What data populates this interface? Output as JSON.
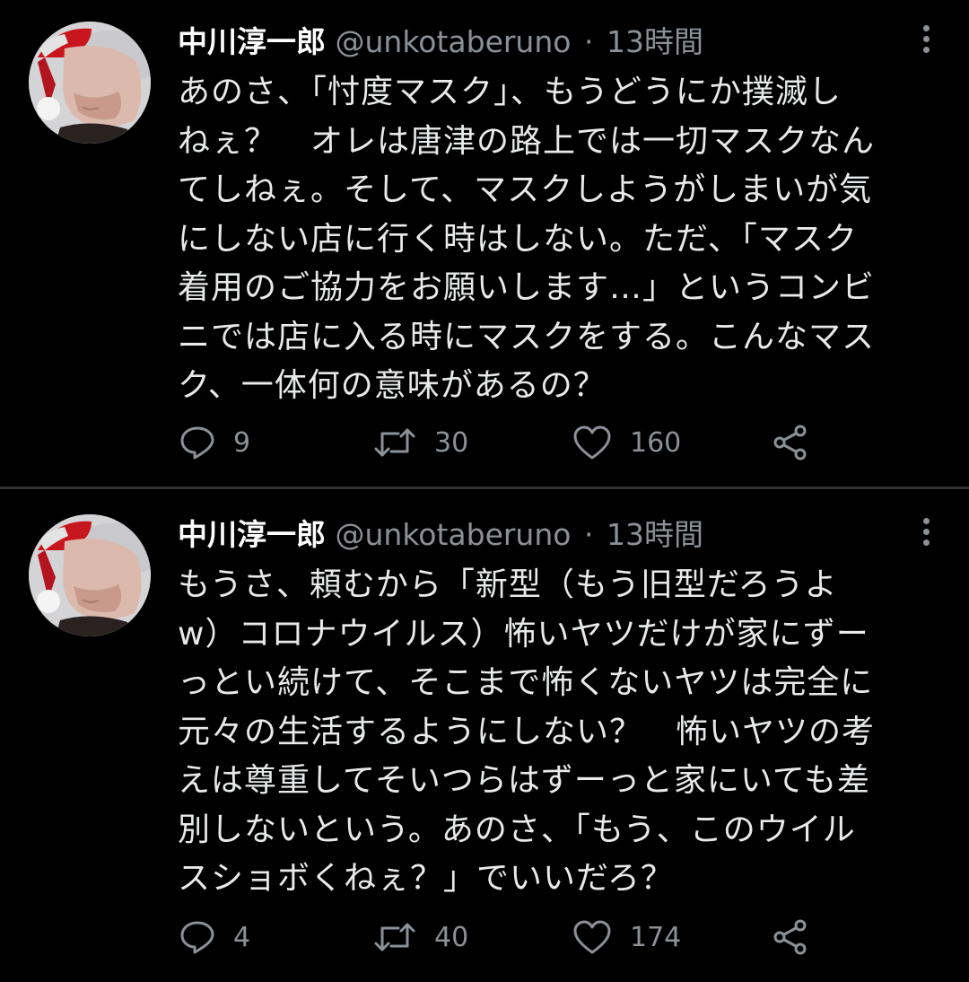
{
  "tweets": [
    {
      "author_name": "中川淳一郎",
      "handle": "@unkotaberuno",
      "separator": "·",
      "time": "13時間",
      "lines": [
        "あのさ、「忖度マスク」、もうどうにか撲滅し",
        "ねぇ？　オレは唐津の路上では一切マスクなん",
        "てしねぇ。そして、マスクしようがしまいが気",
        "にしない店に行く時はしない。ただ、「マスク",
        "着用のご協力をお願いします…」というコンビ",
        "ニでは店に入る時にマスクをする。こんなマス",
        "ク、一体何の意味があるの？"
      ],
      "replies": "9",
      "retweets": "30",
      "likes": "160"
    },
    {
      "author_name": "中川淳一郎",
      "handle": "@unkotaberuno",
      "separator": "·",
      "time": "13時間",
      "lines": [
        "もうさ、頼むから「新型（もう旧型だろうよ",
        "w）コロナウイルス）怖いヤツだけが家にずー",
        "っとい続けて、そこまで怖くないヤツは完全に",
        "元々の生活するようにしない？　怖いヤツの考",
        "えは尊重してそいつらはずーっと家にいても差",
        "別しないという。あのさ、「もう、このウイル",
        "スショボくねぇ？」でいいだろ？"
      ],
      "replies": "4",
      "retweets": "40",
      "likes": "174"
    }
  ],
  "icons": {
    "reply": "reply-icon",
    "retweet": "retweet-icon",
    "like": "heart-icon",
    "share": "share-icon",
    "more": "more-vertical-icon"
  },
  "colors": {
    "background": "#000000",
    "text": "#e7e9ea",
    "secondary": "#8b9196",
    "divider": "#2f3336"
  }
}
